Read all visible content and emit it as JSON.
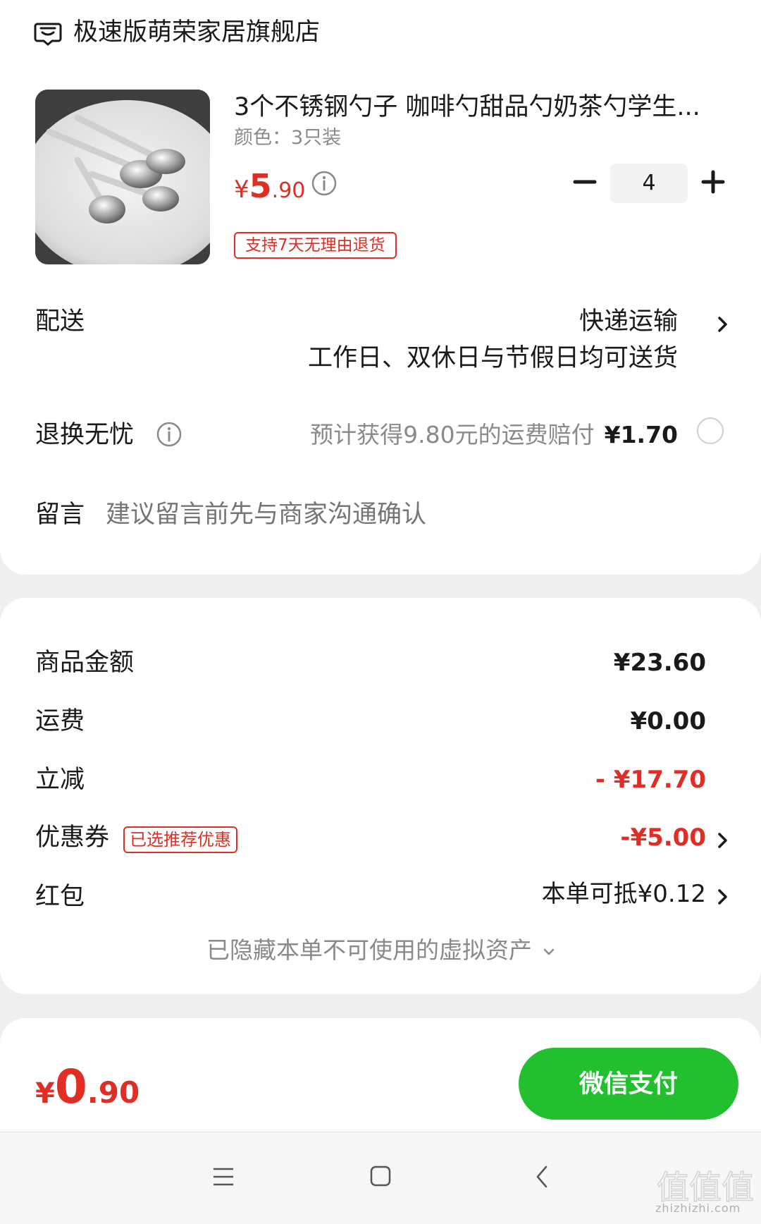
{
  "store": {
    "name": "极速版萌荣家居旗舰店",
    "icon": "store-icon"
  },
  "product": {
    "title": "3个不锈钢勺子 咖啡勺甜品勺奶茶勺学生...",
    "spec": "颜色：3只装",
    "price_currency": "¥",
    "price_int": "5",
    "price_dec": ".90",
    "quantity": "4",
    "return_badge": "支持7天无理由退货"
  },
  "delivery": {
    "label": "配送",
    "method": "快递运输",
    "note": "工作日、双休日与节假日均可送货"
  },
  "return_worry": {
    "label": "退换无忧",
    "text": "预计获得9.80元的运费赔付",
    "amount": "¥1.70"
  },
  "message": {
    "label": "留言",
    "placeholder": "建议留言前先与商家沟通确认"
  },
  "summary": {
    "goods_label": "商品金额",
    "goods_value": "¥23.60",
    "shipping_label": "运费",
    "shipping_value": "¥0.00",
    "discount_label": "立减",
    "discount_value": "- ¥17.70",
    "coupon_label": "优惠券",
    "coupon_badge": "已选推荐优惠",
    "coupon_value": "-¥5.00",
    "redpacket_label": "红包",
    "redpacket_value": "本单可抵¥0.12",
    "hidden_assets": "已隐藏本单不可使用的虚拟资产"
  },
  "pay": {
    "total_currency": "¥",
    "total_int": "0",
    "total_dec": ".90",
    "button": "微信支付"
  },
  "watermark": {
    "text": "zhizhizhi.com",
    "logo_text": "值值值"
  },
  "colors": {
    "accent_red": "#e02e24",
    "pay_green": "#22c02f"
  }
}
